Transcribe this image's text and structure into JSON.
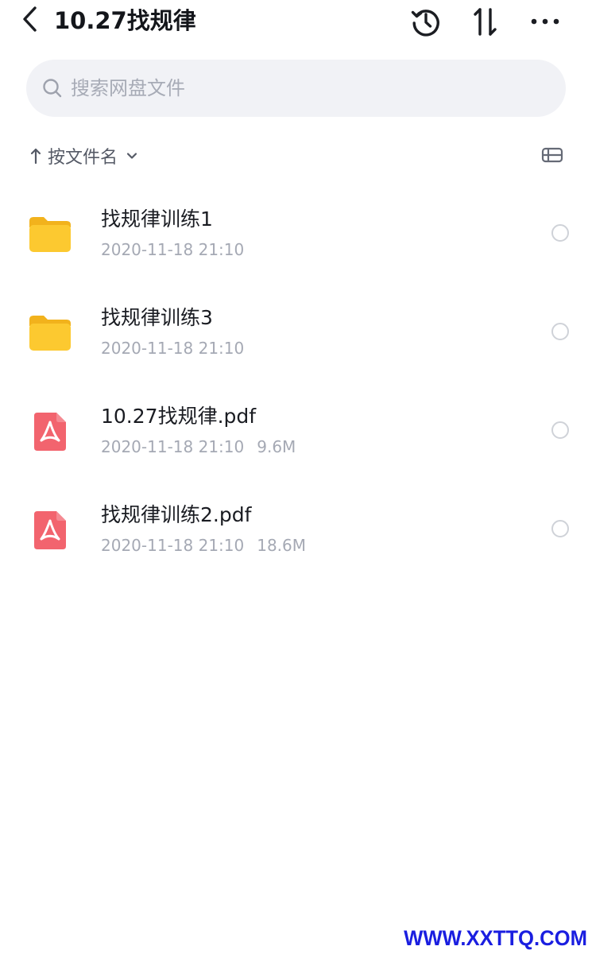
{
  "header": {
    "title": "10.27找规律",
    "back_icon": "chevron-left-icon",
    "history_icon": "history-icon",
    "sort_icon": "sort-arrows-icon",
    "more_icon": "more-dots-icon"
  },
  "search": {
    "placeholder": "搜索网盘文件",
    "value": "",
    "icon": "search-icon"
  },
  "sort": {
    "label": "按文件名",
    "direction_icon": "arrow-up-icon",
    "dropdown_icon": "chevron-down-icon",
    "view_toggle_icon": "list-view-icon"
  },
  "files": [
    {
      "type": "folder",
      "icon": "folder-icon",
      "name": "找规律训练1",
      "date": "2020-11-18 21:10",
      "size": ""
    },
    {
      "type": "folder",
      "icon": "folder-icon",
      "name": "找规律训练3",
      "date": "2020-11-18 21:10",
      "size": ""
    },
    {
      "type": "pdf",
      "icon": "pdf-file-icon",
      "name": "10.27找规律.pdf",
      "date": "2020-11-18 21:10",
      "size": "9.6M"
    },
    {
      "type": "pdf",
      "icon": "pdf-file-icon",
      "name": "找规律训练2.pdf",
      "date": "2020-11-18 21:10",
      "size": "18.6M"
    }
  ],
  "watermark": "WWW.XXTTQ.COM",
  "colors": {
    "folder": "#f9c22a",
    "pdf": "#f2646e",
    "search_bg": "#f1f2f6",
    "meta_text": "#a5a9b4",
    "watermark": "#1a1ee0"
  }
}
